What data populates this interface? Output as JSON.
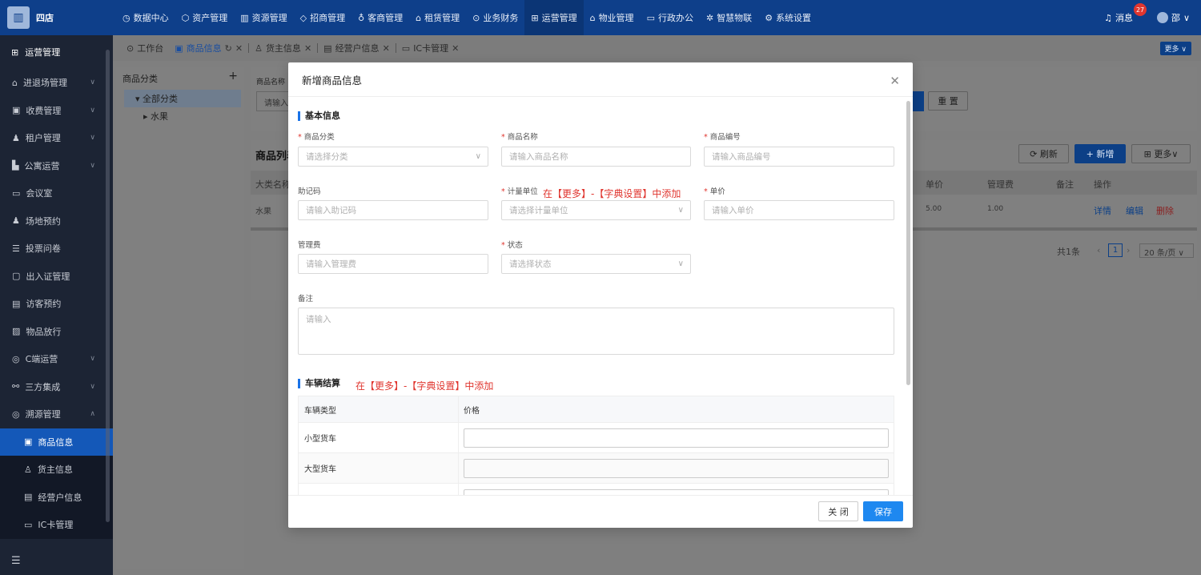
{
  "topbar": {
    "brand": "四店",
    "nav": [
      {
        "icon": "dashboard-icon",
        "glyph": "◷",
        "label": "数据中心"
      },
      {
        "icon": "cube-icon",
        "glyph": "⬡",
        "label": "资产管理"
      },
      {
        "icon": "building-icon",
        "glyph": "▥",
        "label": "资源管理"
      },
      {
        "icon": "tag-icon",
        "glyph": "◇",
        "label": "招商管理"
      },
      {
        "icon": "group-icon",
        "glyph": "♁",
        "label": "客商管理"
      },
      {
        "icon": "house-icon",
        "glyph": "⌂",
        "label": "租赁管理"
      },
      {
        "icon": "coin-icon",
        "glyph": "⊙",
        "label": "业务财务"
      },
      {
        "icon": "ops-icon",
        "glyph": "⊞",
        "label": "运营管理"
      },
      {
        "icon": "property-icon",
        "glyph": "⌂",
        "label": "物业管理"
      },
      {
        "icon": "office-icon",
        "glyph": "▭",
        "label": "行政办公"
      },
      {
        "icon": "iot-icon",
        "glyph": "✲",
        "label": "智慧物联"
      },
      {
        "icon": "settings-icon",
        "glyph": "⚙",
        "label": "系统设置"
      }
    ],
    "message_label": "消息",
    "message_count": "27",
    "user_name": "邵"
  },
  "sidebar": {
    "title": "运营管理",
    "items": [
      {
        "icon": "enter-exit-icon",
        "glyph": "⌂",
        "label": "进退场管理",
        "chev": "∨"
      },
      {
        "icon": "fee-icon",
        "glyph": "▣",
        "label": "收费管理",
        "chev": "∨"
      },
      {
        "icon": "tenant-icon",
        "glyph": "♟",
        "label": "租户管理",
        "chev": "∨"
      },
      {
        "icon": "apartment-icon",
        "glyph": "▙",
        "label": "公寓运营",
        "chev": "∨"
      },
      {
        "icon": "meeting-icon",
        "glyph": "▭",
        "label": "会议室",
        "chev": ""
      },
      {
        "icon": "venue-icon",
        "glyph": "♟",
        "label": "场地预约",
        "chev": ""
      },
      {
        "icon": "vote-icon",
        "glyph": "☰",
        "label": "投票问卷",
        "chev": ""
      },
      {
        "icon": "pass-icon",
        "glyph": "▢",
        "label": "出入证管理",
        "chev": ""
      },
      {
        "icon": "visitor-icon",
        "glyph": "▤",
        "label": "访客预约",
        "chev": ""
      },
      {
        "icon": "goods-release-icon",
        "glyph": "▨",
        "label": "物品放行",
        "chev": ""
      },
      {
        "icon": "c-end-icon",
        "glyph": "◎",
        "label": "C端运营",
        "chev": "∨"
      },
      {
        "icon": "integration-icon",
        "glyph": "⚯",
        "label": "三方集成",
        "chev": "∨"
      },
      {
        "icon": "trace-icon",
        "glyph": "◎",
        "label": "溯源管理",
        "chev": "∧"
      }
    ],
    "subitems": [
      {
        "icon": "product-icon",
        "glyph": "▣",
        "label": "商品信息",
        "active": true
      },
      {
        "icon": "shipper-icon",
        "glyph": "♙",
        "label": "货主信息",
        "active": false
      },
      {
        "icon": "merchant-icon",
        "glyph": "▤",
        "label": "经营户信息",
        "active": false
      },
      {
        "icon": "ic-card-icon",
        "glyph": "▭",
        "label": "IC卡管理",
        "active": false
      }
    ]
  },
  "tabs": [
    {
      "icon": "workbench-icon",
      "glyph": "⊙",
      "label": "工作台",
      "active": false,
      "refresh": "",
      "close": ""
    },
    {
      "icon": "product-icon",
      "glyph": "▣",
      "label": "商品信息",
      "active": true,
      "refresh": "↻",
      "close": "✕"
    },
    {
      "icon": "shipper-icon",
      "glyph": "♙",
      "label": "货主信息",
      "active": false,
      "refresh": "",
      "close": "✕"
    },
    {
      "icon": "merchant-icon",
      "glyph": "▤",
      "label": "经营户信息",
      "active": false,
      "refresh": "",
      "close": "✕"
    },
    {
      "icon": "ic-card-icon",
      "glyph": "▭",
      "label": "IC卡管理",
      "active": false,
      "refresh": "",
      "close": "✕"
    }
  ],
  "tab_more": "更多 ∨",
  "tree": {
    "title": "商品分类",
    "add": "+",
    "root": "全部分类",
    "child": "水果"
  },
  "background": {
    "filter_label": "商品名称",
    "filter_placeholder": "请输入",
    "reset": "重 置",
    "list_title": "商品列表",
    "refresh": "刷新",
    "add": "新增",
    "more": "更多∨",
    "col_category": "大类名称",
    "col_price": "单价",
    "col_fee": "管理费",
    "col_remark": "备注",
    "col_action": "操作",
    "row_category": "水果",
    "row_price": "5.00",
    "row_fee": "1.00",
    "act_detail": "详情",
    "act_edit": "编辑",
    "act_delete": "删除",
    "total": "共1条",
    "page": "1",
    "page_size": "20 条/页 ∨"
  },
  "modal": {
    "title": "新增商品信息",
    "section_basic": "基本信息",
    "fields": {
      "category": {
        "label": "商品分类",
        "placeholder": "请选择分类"
      },
      "name": {
        "label": "商品名称",
        "placeholder": "请输入商品名称"
      },
      "code": {
        "label": "商品编号",
        "placeholder": "请输入商品编号"
      },
      "mnemonic": {
        "label": "助记码",
        "placeholder": "请输入助记码"
      },
      "unit": {
        "label": "计量单位",
        "placeholder": "请选择计量单位"
      },
      "price": {
        "label": "单价",
        "placeholder": "请输入单价"
      },
      "fee": {
        "label": "管理费",
        "placeholder": "请输入管理费"
      },
      "status": {
        "label": "状态",
        "placeholder": "请选择状态"
      },
      "remark": {
        "label": "备注",
        "placeholder": "请输入"
      }
    },
    "hint_unit": "在【更多】-【字典设置】中添加",
    "section_vehicle": "车辆结算",
    "hint_vehicle": "在【更多】-【字典设置】中添加",
    "vehicle_headers": [
      "车辆类型",
      "价格"
    ],
    "vehicle_rows": [
      "小型货车",
      "大型货车"
    ],
    "close": "关 闭",
    "save": "保存"
  }
}
